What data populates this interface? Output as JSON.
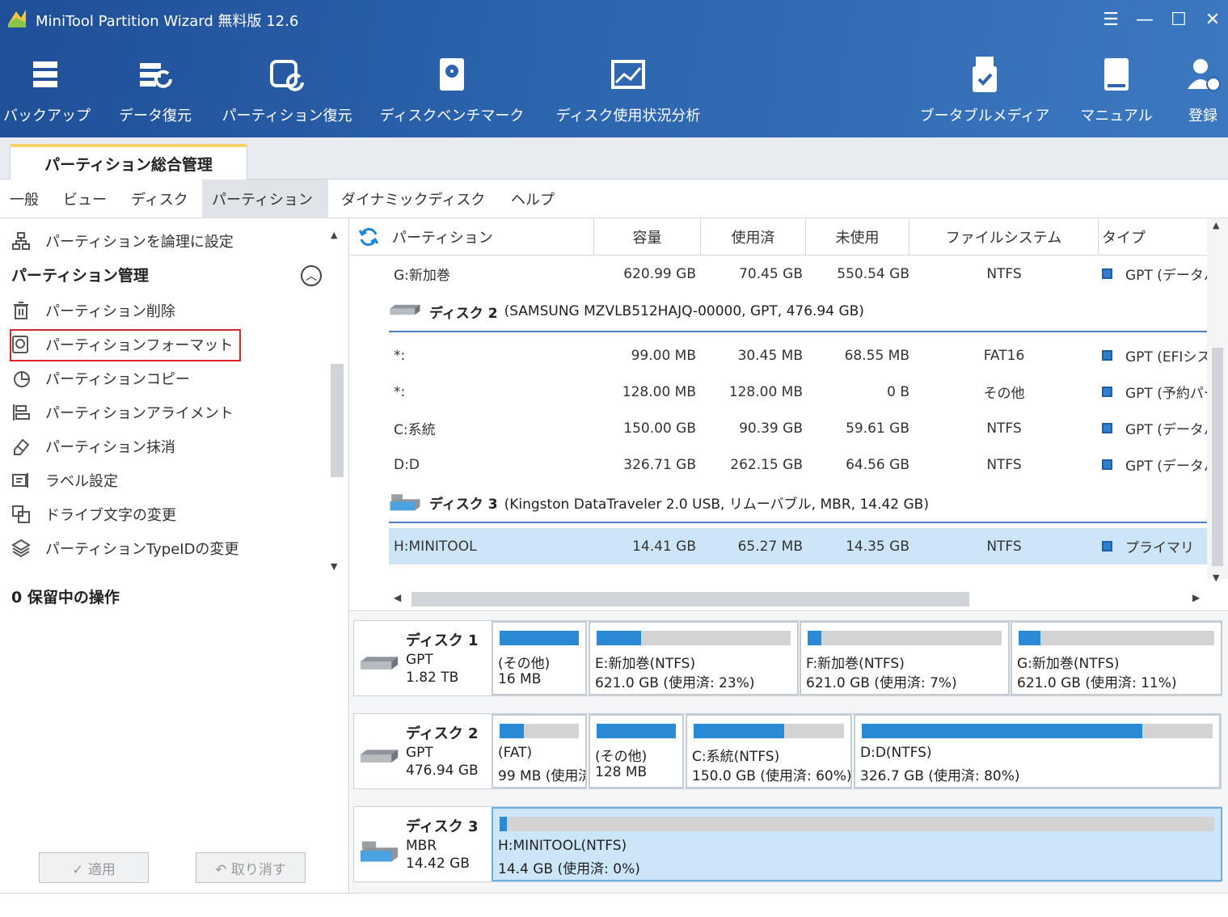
{
  "app": {
    "title": "MiniTool Partition Wizard 無料版 12.6",
    "window_controls": [
      "☰",
      "—",
      "☐",
      "✕"
    ]
  },
  "toolbar": {
    "left": [
      {
        "label": "バックアップ",
        "icon": "backup-icon"
      },
      {
        "label": "データ復元",
        "icon": "data-recovery-icon"
      },
      {
        "label": "パーティション復元",
        "icon": "partition-recovery-icon"
      },
      {
        "label": "ディスクベンチマーク",
        "icon": "disk-benchmark-icon"
      },
      {
        "label": "ディスク使用状況分析",
        "icon": "space-analyzer-icon"
      }
    ],
    "right": [
      {
        "label": "ブータブルメディア",
        "icon": "bootable-media-icon"
      },
      {
        "label": "マニュアル",
        "icon": "manual-icon"
      },
      {
        "label": "登録",
        "icon": "register-icon"
      }
    ]
  },
  "main_tab": "パーティション総合管理",
  "menu": [
    "一般",
    "ビュー",
    "ディスク",
    "パーティション",
    "ダイナミックディスク",
    "ヘルプ"
  ],
  "left_panel": {
    "top_item": "パーティションを論理に設定",
    "section": "パーティション管理",
    "items": [
      "パーティション削除",
      "パーティションフォーマット",
      "パーティションコピー",
      "パーティションアライメント",
      "パーティション抹消",
      "ラベル設定",
      "ドライブ文字の変更",
      "パーティションTypeIDの変更"
    ],
    "pending": "0 保留中の操作",
    "apply": "✓ 適用",
    "undo": "↶ 取り消す"
  },
  "table": {
    "headers": [
      "パーティション",
      "容量",
      "使用済",
      "未使用",
      "ファイルシステム",
      "タイプ"
    ],
    "rows": [
      {
        "kind": "part",
        "name": "G:新加巻",
        "cap": "620.99 GB",
        "used": "70.45 GB",
        "free": "550.54 GB",
        "fs": "NTFS",
        "type": "GPT (データパ"
      },
      {
        "kind": "disk",
        "name": "ディスク 2",
        "desc": "(SAMSUNG MZVLB512HAJQ-00000, GPT, 476.94 GB)"
      },
      {
        "kind": "part",
        "name": "*:",
        "cap": "99.00 MB",
        "used": "30.45 MB",
        "free": "68.55 MB",
        "fs": "FAT16",
        "type": "GPT (EFIシス"
      },
      {
        "kind": "part",
        "name": "*:",
        "cap": "128.00 MB",
        "used": "128.00 MB",
        "free": "0 B",
        "fs": "その他",
        "type": "GPT (予約パー"
      },
      {
        "kind": "part",
        "name": "C:系統",
        "cap": "150.00 GB",
        "used": "90.39 GB",
        "free": "59.61 GB",
        "fs": "NTFS",
        "type": "GPT (データパ"
      },
      {
        "kind": "part",
        "name": "D:D",
        "cap": "326.71 GB",
        "used": "262.15 GB",
        "free": "64.56 GB",
        "fs": "NTFS",
        "type": "GPT (データパ"
      },
      {
        "kind": "disk",
        "name": "ディスク 3",
        "desc": "(Kingston DataTraveler 2.0 USB, リムーバブル, MBR, 14.42 GB)"
      },
      {
        "kind": "part",
        "name": "H:MINITOOL",
        "cap": "14.41 GB",
        "used": "65.27 MB",
        "free": "14.35 GB",
        "fs": "NTFS",
        "type": "プライマリ",
        "selected": true
      }
    ]
  },
  "diskmap": [
    {
      "name": "ディスク 1",
      "scheme": "GPT",
      "size": "1.82 TB",
      "parts": [
        {
          "l1": "(その他)",
          "l2": "16 MB",
          "fill": 1.0
        },
        {
          "l1": "E:新加巻(NTFS)",
          "l2": "621.0 GB (使用済: 23%)",
          "fill": 0.23
        },
        {
          "l1": "F:新加巻(NTFS)",
          "l2": "621.0 GB (使用済: 7%)",
          "fill": 0.07
        },
        {
          "l1": "G:新加巻(NTFS)",
          "l2": "621.0 GB (使用済: 11%)",
          "fill": 0.11
        }
      ]
    },
    {
      "name": "ディスク 2",
      "scheme": "GPT",
      "size": "476.94 GB",
      "parts": [
        {
          "l1": "(FAT)",
          "l2": "99 MB (使用済",
          "fill": 0.31
        },
        {
          "l1": "(その他)",
          "l2": "128 MB",
          "fill": 1.0
        },
        {
          "l1": "C:系統(NTFS)",
          "l2": "150.0 GB (使用済: 60%)",
          "fill": 0.6
        },
        {
          "l1": "D:D(NTFS)",
          "l2": "326.7 GB (使用済: 80%)",
          "fill": 0.8
        }
      ]
    },
    {
      "name": "ディスク 3",
      "scheme": "MBR",
      "size": "14.42 GB",
      "parts": [
        {
          "l1": "H:MINITOOL(NTFS)",
          "l2": "14.4 GB (使用済: 0%)",
          "fill": 0.005,
          "selected": true
        }
      ]
    }
  ]
}
